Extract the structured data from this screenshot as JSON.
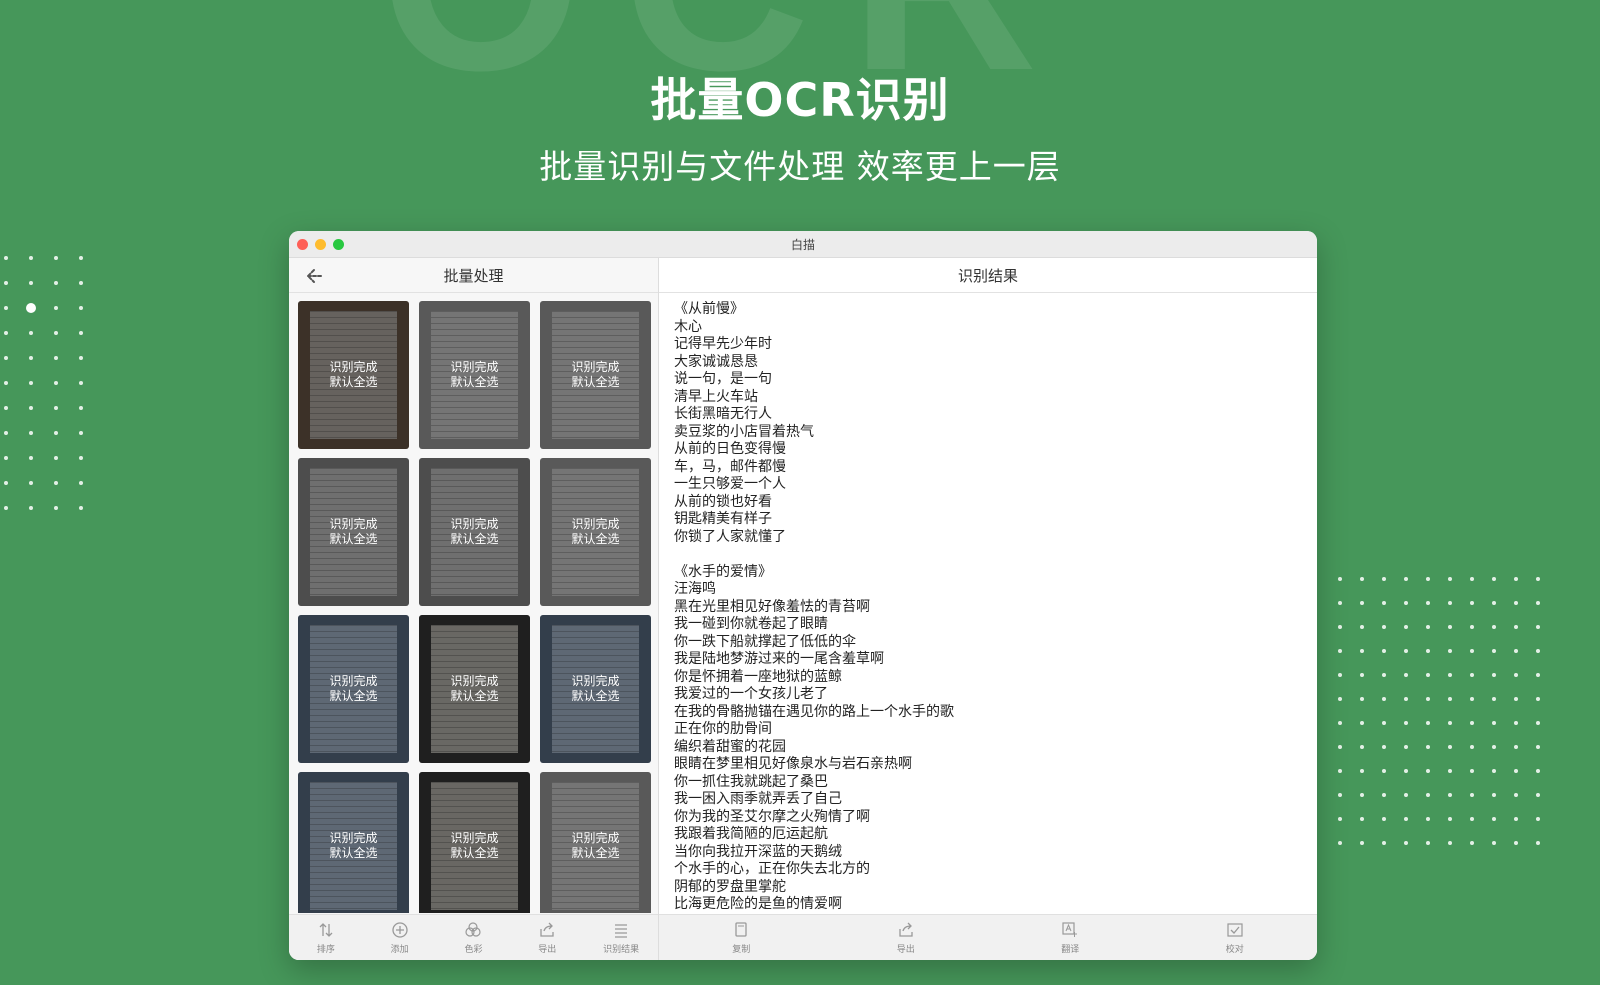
{
  "background_text": "OCR",
  "hero": {
    "title": "批量OCR识别",
    "subtitle": "批量识别与文件处理 效率更上一层"
  },
  "window": {
    "title": "白描",
    "left_pane": {
      "header": "批量处理",
      "back_icon": "back-arrow-icon",
      "thumbnails": [
        {
          "status_line1": "识别完成",
          "status_line2": "默认全选"
        },
        {
          "status_line1": "识别完成",
          "status_line2": "默认全选"
        },
        {
          "status_line1": "识别完成",
          "status_line2": "默认全选"
        },
        {
          "status_line1": "识别完成",
          "status_line2": "默认全选"
        },
        {
          "status_line1": "识别完成",
          "status_line2": "默认全选"
        },
        {
          "status_line1": "识别完成",
          "status_line2": "默认全选"
        },
        {
          "status_line1": "识别完成",
          "status_line2": "默认全选"
        },
        {
          "status_line1": "识别完成",
          "status_line2": "默认全选"
        },
        {
          "status_line1": "识别完成",
          "status_line2": "默认全选"
        },
        {
          "status_line1": "识别完成",
          "status_line2": "默认全选"
        },
        {
          "status_line1": "识别完成",
          "status_line2": "默认全选"
        },
        {
          "status_line1": "识别完成",
          "status_line2": "默认全选"
        }
      ],
      "toolbar": [
        {
          "label": "排序",
          "icon": "sort-icon"
        },
        {
          "label": "添加",
          "icon": "add-icon"
        },
        {
          "label": "色彩",
          "icon": "color-icon"
        },
        {
          "label": "导出",
          "icon": "export-icon"
        },
        {
          "label": "识别结果",
          "icon": "list-icon"
        }
      ]
    },
    "right_pane": {
      "header": "识别结果",
      "text": "《从前慢》\n木心\n记得早先少年时\n大家诚诚恳恳\n说一句，是一句\n清早上火车站\n长街黑暗无行人\n卖豆浆的小店冒着热气\n从前的日色变得慢\n车，马，邮件都慢\n一生只够爱一个人\n从前的锁也好看\n钥匙精美有样子\n你锁了人家就懂了\n\n《水手的爱情》\n汪海鸣\n黑在光里相见好像羞怯的青苔啊\n我一碰到你就卷起了眼睛\n你一跌下船就撑起了低低的伞\n我是陆地梦游过来的一尾含羞草啊\n你是怀拥着一座地狱的蓝鲸\n我爱过的一个女孩儿老了\n在我的骨骼抛锚在遇见你的路上一个水手的歌\n正在你的肋骨间\n编织着甜蜜的花园\n眼睛在梦里相见好像泉水与岩石亲热啊\n你一抓住我就跳起了桑巴\n我一困入雨季就弄丢了自己\n你为我的圣艾尔摩之火殉情了啊\n我跟着我简陋的厄运起航\n当你向我拉开深蓝的天鹅绒\n个水手的心，正在你失去北方的\n阴郁的罗盘里掌舵\n比海更危险的是鱼的情爱啊",
      "toolbar": [
        {
          "label": "复制",
          "icon": "copy-icon"
        },
        {
          "label": "导出",
          "icon": "export-icon"
        },
        {
          "label": "翻译",
          "icon": "translate-icon"
        },
        {
          "label": "校对",
          "icon": "proofread-icon"
        }
      ]
    }
  },
  "colors": {
    "background": "#46975a",
    "window_bg": "#ffffff",
    "toolbar_bg": "#f1f1f1"
  }
}
